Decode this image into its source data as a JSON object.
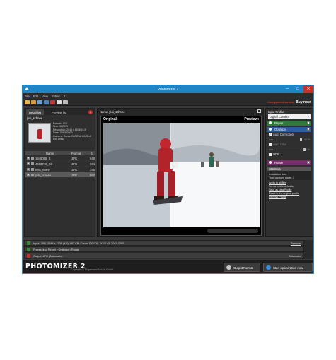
{
  "window": {
    "title": "Photomizer 2"
  },
  "menu": [
    "File",
    "Edit",
    "View",
    "Extras",
    "?"
  ],
  "toolbar": {
    "registration": "Unregistered version",
    "buy_now": "Buy now"
  },
  "left_panel": {
    "tabs": [
      "Detail list",
      "Preview list"
    ],
    "selected_name": "josi_schnee",
    "meta": [
      "Format: JPG",
      "Size: 982 KB",
      "Resolution: 2048 x 1536 (4:3)",
      "Date: 30/01/2005",
      "Camera: Canon DIGITAL IXUS v3",
      "Exif Data"
    ],
    "columns": [
      "Name",
      "Format",
      "S"
    ],
    "files": [
      {
        "name": "1548088_S",
        "format": "JPG",
        "size": "848",
        "checked": true
      },
      {
        "name": "4663746_XS",
        "format": "JPG",
        "size": "664",
        "checked": true
      },
      {
        "name": "IMG_6069",
        "format": "JPG",
        "size": "345",
        "checked": true
      },
      {
        "name": "josi_schnee",
        "format": "JPG",
        "size": "982",
        "checked": true
      }
    ]
  },
  "center": {
    "name_line": "Name: josi_schnee",
    "original_label": "Original:",
    "preview_label": "Preview:"
  },
  "right_panel": {
    "profile_label": "Input Profile:",
    "profile_value": "Digital Camera",
    "sections": {
      "repair": "Repair",
      "optimize": "Optimize",
      "rotate": "Rotate",
      "statistics": "Statistics"
    },
    "options": {
      "auto_correction": "Auto Correction",
      "auto_color": "Auto color",
      "hdr": "HDR"
    },
    "slider1": {
      "low": "Low",
      "high": "High",
      "value": "90 %"
    },
    "slider2": {
      "low": "Low",
      "high": "High",
      "value": "100 %"
    },
    "stats_lines": [
      "Installation date:",
      "Total program starts: 4"
    ],
    "links": [
      "Apply to all files",
      "Set as profile defaults",
      "Save as New Profile",
      "Reset to the original profile",
      "Remove Profile"
    ]
  },
  "bottom": {
    "input": "Input: JPG, 2048 x 1536 (4:3), 982 KB, Canon DIGITAL IXUS v3, 30/01/2005",
    "input_action": "Remove",
    "processing": "Processing: Repair  •  Optimize  •  Rotate",
    "output": "Output: JPG (Automatic)",
    "output_action": "Automatic"
  },
  "footer": {
    "brand": "PHOTOMIZER 2",
    "copyright": "Copyright © Engelmann Media GmbH",
    "output_format": "Output Format",
    "start": "Start optimization now"
  },
  "colors": {
    "titlebar": "#1f85c6",
    "repair": "#2f7a3a",
    "optimize": "#2a5f99",
    "rotate": "#7a2a6a",
    "close": "#c8312a"
  }
}
